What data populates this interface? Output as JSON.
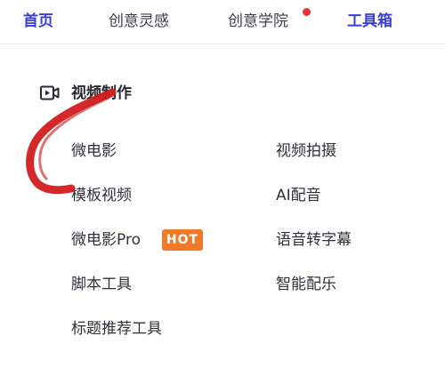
{
  "topnav": {
    "items": [
      {
        "label": "首页",
        "active": true
      },
      {
        "label": "创意灵感",
        "active": false
      },
      {
        "label": "创意学院",
        "active": false,
        "notification_dot": true
      },
      {
        "label": "工具箱",
        "active": true
      }
    ]
  },
  "section": {
    "icon": "video-camera-icon",
    "title": "视频制作"
  },
  "tools": {
    "left": [
      {
        "label": "微电影"
      },
      {
        "label": "模板视频"
      },
      {
        "label": "微电影Pro",
        "badge": "HOT"
      },
      {
        "label": "脚本工具"
      },
      {
        "label": "标题推荐工具"
      }
    ],
    "right": [
      {
        "label": "视频拍摄"
      },
      {
        "label": "AI配音"
      },
      {
        "label": "语音转字幕"
      },
      {
        "label": "智能配乐"
      }
    ]
  },
  "annotation": {
    "type": "hand-drawn-c-stroke",
    "color": "#d21e1e"
  },
  "colors": {
    "accent": "#3a3fd0",
    "hot_badge": "#f07a2a",
    "notification_dot": "#e8333a"
  }
}
